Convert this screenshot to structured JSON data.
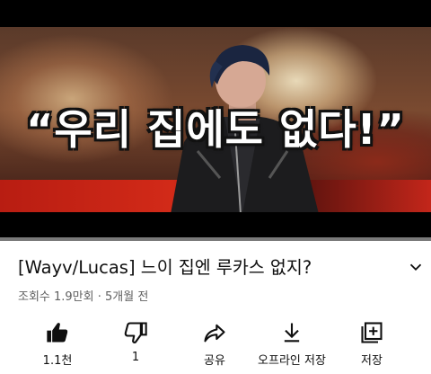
{
  "video": {
    "overlay_text": "“우리 집에도 없다!”"
  },
  "title": "[Wayv/Lucas] 느이 집엔 루카스 없지?",
  "meta": "조회수 1.9만회 · 5개월 전",
  "actions": [
    {
      "icon": "thumbs-up-icon",
      "label": "1.1천"
    },
    {
      "icon": "thumbs-down-icon",
      "label": "1"
    },
    {
      "icon": "share-icon",
      "label": "공유"
    },
    {
      "icon": "download-icon",
      "label": "오프라인 저장"
    },
    {
      "icon": "add-to-playlist-icon",
      "label": "저장"
    }
  ],
  "colors": {
    "text_primary": "#0f0f0f",
    "text_secondary": "#606060",
    "progress_bar": "#7a7a7a"
  }
}
